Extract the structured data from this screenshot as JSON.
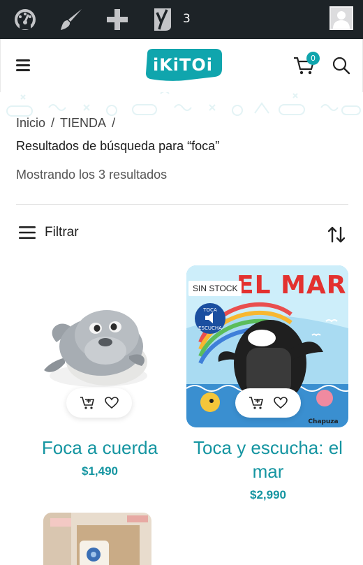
{
  "admin_bar": {
    "icons": [
      "dashboard-icon",
      "brush-icon",
      "plus-icon",
      "yoast-icon"
    ],
    "yoast_count": "3",
    "avatar": "avatar-icon"
  },
  "header": {
    "logo_text": "iKiTOi",
    "cart_count": "0",
    "icons": [
      "menu-icon",
      "cart-icon",
      "search-icon"
    ]
  },
  "breadcrumb": {
    "items": [
      "Inicio",
      "TIENDA"
    ],
    "separator": "/"
  },
  "search": {
    "results_title": "Resultados de búsqueda para “foca”",
    "results_count": "Mostrando los 3 resultados"
  },
  "toolbar": {
    "filter_label": "Filtrar"
  },
  "products": [
    {
      "name": "Foca a cuerda",
      "price": "$1,490",
      "badge": ""
    },
    {
      "name": "Toca y escucha: el mar",
      "name_line1": "Toca y escucha: el",
      "name_line2": "mar",
      "price": "$2,990",
      "badge": "SIN STOCK",
      "book_title": "EL MAR"
    },
    {
      "name": "",
      "price": "",
      "badge": ""
    }
  ],
  "colors": {
    "accent": "#10a5ad",
    "link": "#1595a1",
    "admin_bar": "#1d2327"
  }
}
